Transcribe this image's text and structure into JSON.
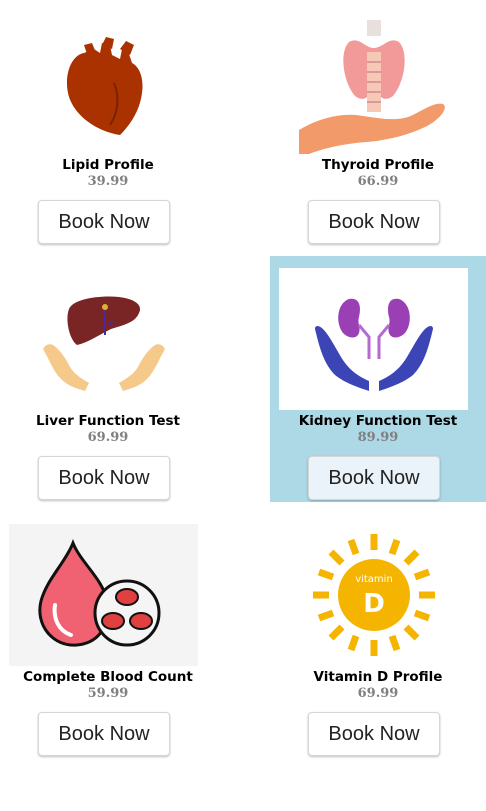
{
  "products": [
    {
      "name": "Lipid Profile",
      "price": "39.99",
      "button": "Book Now",
      "icon": "heart-icon"
    },
    {
      "name": "Thyroid Profile",
      "price": "66.99",
      "button": "Book Now",
      "icon": "thyroid-icon"
    },
    {
      "name": "Liver Function Test",
      "price": "69.99",
      "button": "Book Now",
      "icon": "liver-icon"
    },
    {
      "name": "Kidney Function Test",
      "price": "89.99",
      "button": "Book Now",
      "icon": "kidney-icon"
    },
    {
      "name": "Complete Blood Count",
      "price": "59.99",
      "button": "Book Now",
      "icon": "blood-drop-icon"
    },
    {
      "name": "Vitamin D Profile",
      "price": "69.99",
      "button": "Book Now",
      "icon": "vitamin-d-icon",
      "icon_text_top": "vitamin",
      "icon_text_main": "D"
    }
  ],
  "colors": {
    "highlight": "#add8e6",
    "price": "#808080"
  }
}
